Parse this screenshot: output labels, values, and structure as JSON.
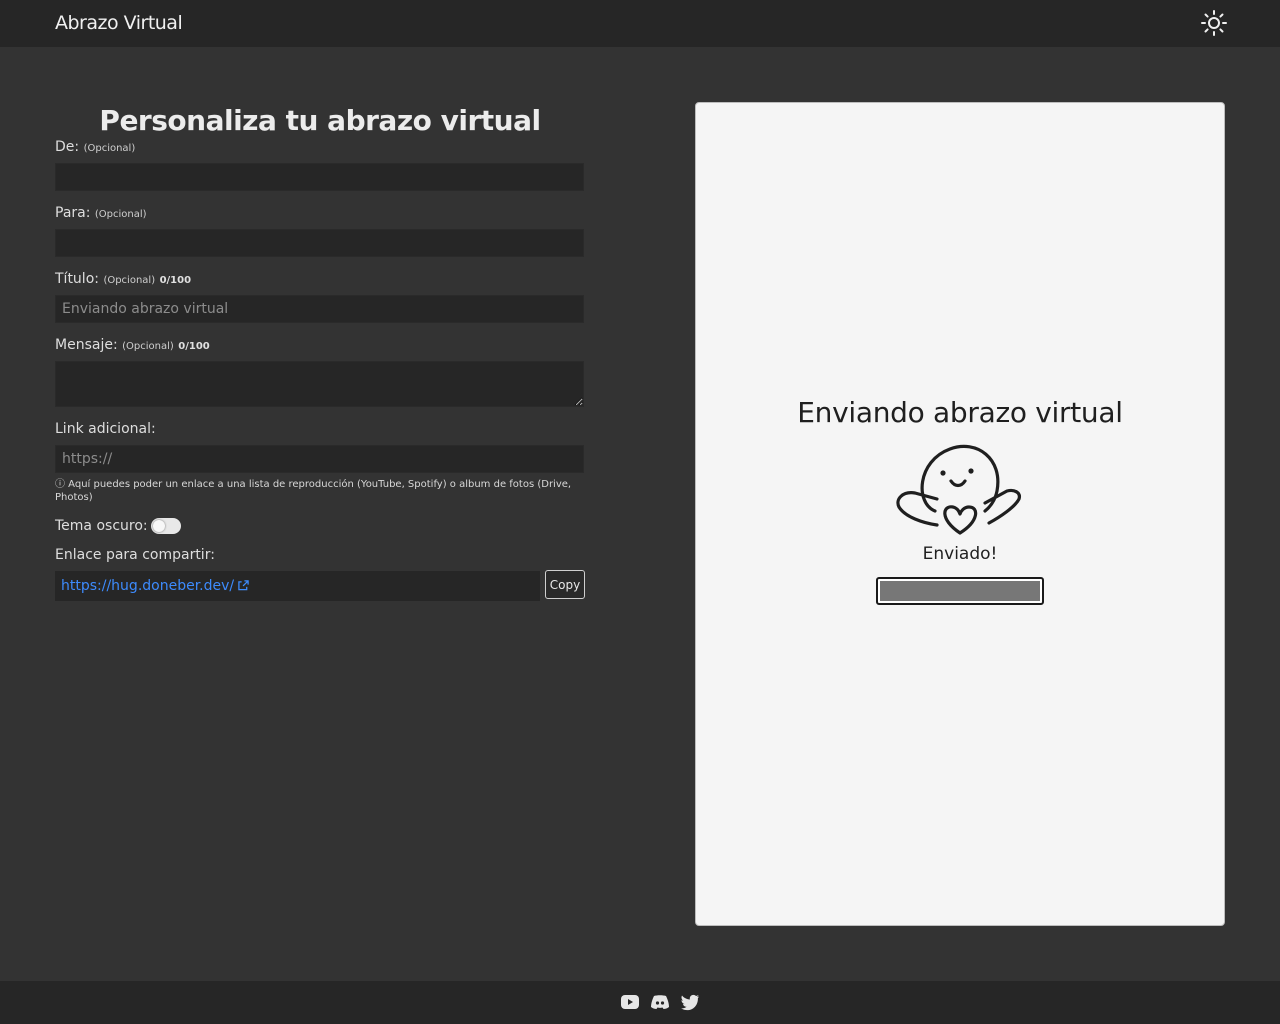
{
  "navbar": {
    "brand": "Abrazo Virtual",
    "theme_toggle_icon": "sun-icon"
  },
  "form": {
    "title": "Personaliza tu abrazo virtual",
    "from": {
      "label": "De:",
      "optional": "(Opcional)",
      "value": ""
    },
    "to": {
      "label": "Para:",
      "optional": "(Opcional)",
      "value": ""
    },
    "title_field": {
      "label": "Título:",
      "optional": "(Opcional)",
      "counter": "0/100",
      "value": "",
      "placeholder": "Enviando abrazo virtual"
    },
    "message": {
      "label": "Mensaje:",
      "optional": "(Opcional)",
      "counter": "0/100",
      "value": ""
    },
    "link": {
      "label": "Link adicional:",
      "placeholder": "https://",
      "value": "",
      "hint": "ⓘ Aquí puedes poder un enlace a una lista de reproducción (YouTube, Spotify) o album de fotos (Drive, Photos)"
    },
    "dark_theme": {
      "label": "Tema oscuro:",
      "enabled": false
    },
    "share": {
      "label": "Enlace para compartir:",
      "url": "https://hug.doneber.dev/",
      "copy_label": "Copy"
    }
  },
  "preview": {
    "title": "Enviando abrazo virtual",
    "status": "Enviado!",
    "progress_percent": 100,
    "mascot_icon": "hugging-ghost-icon"
  },
  "footer": {
    "icons": [
      "youtube-icon",
      "discord-icon",
      "twitter-icon"
    ]
  },
  "colors": {
    "page_bg": "#333333",
    "bar_bg": "#262626",
    "input_bg": "#262626",
    "link": "#3d8bfd",
    "preview_bg": "#f5f5f5",
    "progress_fill": "#777777"
  }
}
